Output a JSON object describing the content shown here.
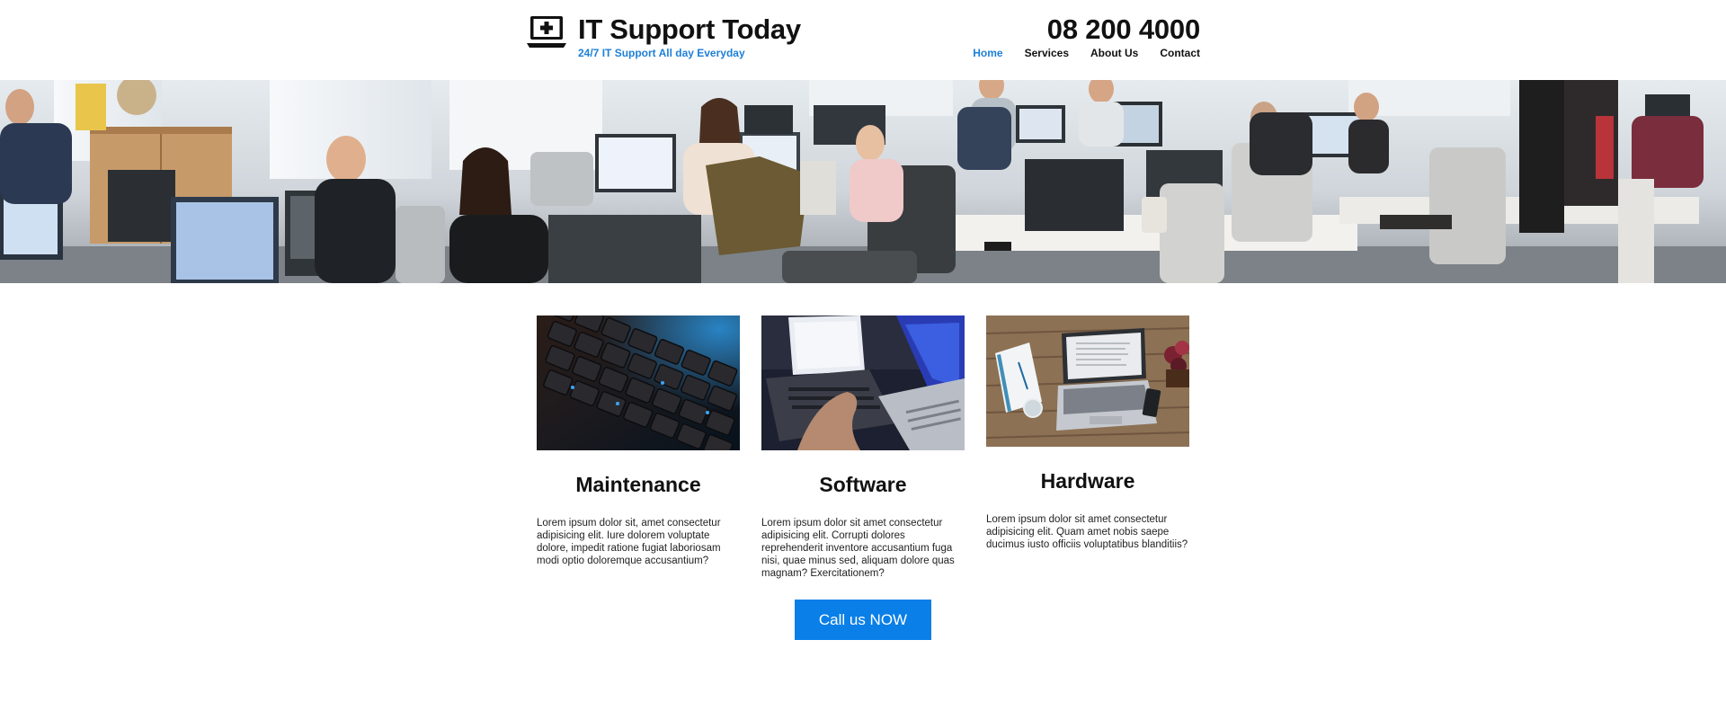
{
  "brand": {
    "icon": "laptop-plus-icon",
    "title": "IT Support Today",
    "tagline": "24/7 IT Support All day Everyday"
  },
  "contact": {
    "phone": "08 200 4000"
  },
  "nav": {
    "items": [
      {
        "label": "Home",
        "active": true
      },
      {
        "label": "Services",
        "active": false
      },
      {
        "label": "About Us",
        "active": false
      },
      {
        "label": "Contact",
        "active": false
      }
    ]
  },
  "hero": {
    "image": "office-workspace-photo"
  },
  "cards": [
    {
      "image": "backlit-keyboard-photo",
      "title": "Maintenance",
      "text": "Lorem ipsum dolor sit, amet consectetur adipisicing elit. Iure dolorem voluptate dolore, impedit ratione fugiat laboriosam modi optio doloremque accusantium?"
    },
    {
      "image": "laptop-typing-photo",
      "title": "Software",
      "text": "Lorem ipsum dolor sit amet consectetur adipisicing elit. Corrupti dolores reprehenderit inventore accusantium fuga nisi, quae minus sed, aliquam dolore quas magnam? Exercitationem?"
    },
    {
      "image": "laptop-on-desk-photo",
      "title": "Hardware",
      "text": "Lorem ipsum dolor sit amet consectetur adipisicing elit. Quam amet nobis saepe ducimus iusto officiis voluptatibus blanditiis?"
    }
  ],
  "cta": {
    "label": "Call us NOW"
  },
  "colors": {
    "accent": "#1e7fd8",
    "cta_background": "#0a7fe8",
    "text": "#111111"
  }
}
